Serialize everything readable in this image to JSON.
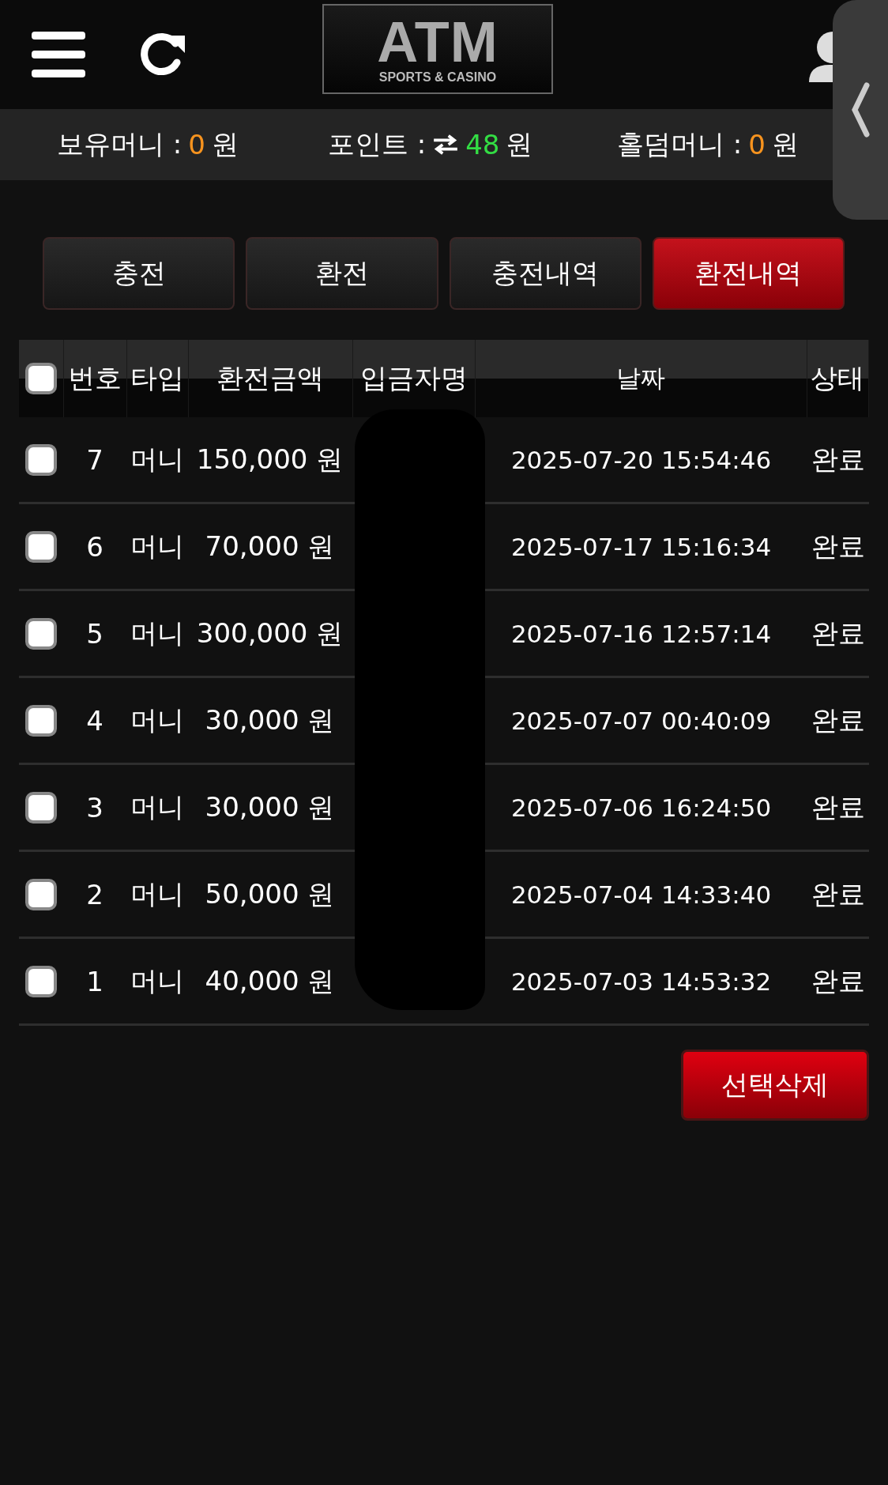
{
  "header": {
    "logo": {
      "title": "ATM",
      "subtitle": "SPORTS & CASINO"
    }
  },
  "balances": [
    {
      "kind": "money",
      "label": "보유머니 :",
      "value": "0",
      "unit": "원",
      "color": "#f7931e"
    },
    {
      "kind": "point",
      "label": "포인트 :",
      "value": "48",
      "unit": "원",
      "color": "#33dd44"
    },
    {
      "kind": "money",
      "label": "홀덤머니 :",
      "value": "0",
      "unit": "원",
      "color": "#f7931e"
    }
  ],
  "tabs": [
    {
      "label": "충전",
      "selected": false
    },
    {
      "label": "환전",
      "selected": false
    },
    {
      "label": "충전내역",
      "selected": false
    },
    {
      "label": "환전내역",
      "selected": true
    }
  ],
  "table": {
    "select_all_checked": false,
    "columns": [
      "번호",
      "타입",
      "환전금액",
      "입금자명",
      "날짜",
      "상태"
    ],
    "rows": [
      {
        "checked": false,
        "cells": [
          "7",
          "머니",
          "150,000 원",
          "",
          "2025-07-20 15:54:46",
          "완료"
        ]
      },
      {
        "checked": false,
        "cells": [
          "6",
          "머니",
          "70,000 원",
          "",
          "2025-07-17 15:16:34",
          "완료"
        ]
      },
      {
        "checked": false,
        "cells": [
          "5",
          "머니",
          "300,000 원",
          "",
          "2025-07-16 12:57:14",
          "완료"
        ]
      },
      {
        "checked": false,
        "cells": [
          "4",
          "머니",
          "30,000 원",
          "",
          "2025-07-07 00:40:09",
          "완료"
        ]
      },
      {
        "checked": false,
        "cells": [
          "3",
          "머니",
          "30,000 원",
          "",
          "2025-07-06 16:24:50",
          "완료"
        ]
      },
      {
        "checked": false,
        "cells": [
          "2",
          "머니",
          "50,000 원",
          "",
          "2025-07-04 14:33:40",
          "완료"
        ]
      },
      {
        "checked": false,
        "cells": [
          "1",
          "머니",
          "40,000 원",
          "",
          "2025-07-03 14:53:32",
          "완료"
        ]
      }
    ]
  },
  "delete_button": {
    "label": "선택삭제"
  }
}
